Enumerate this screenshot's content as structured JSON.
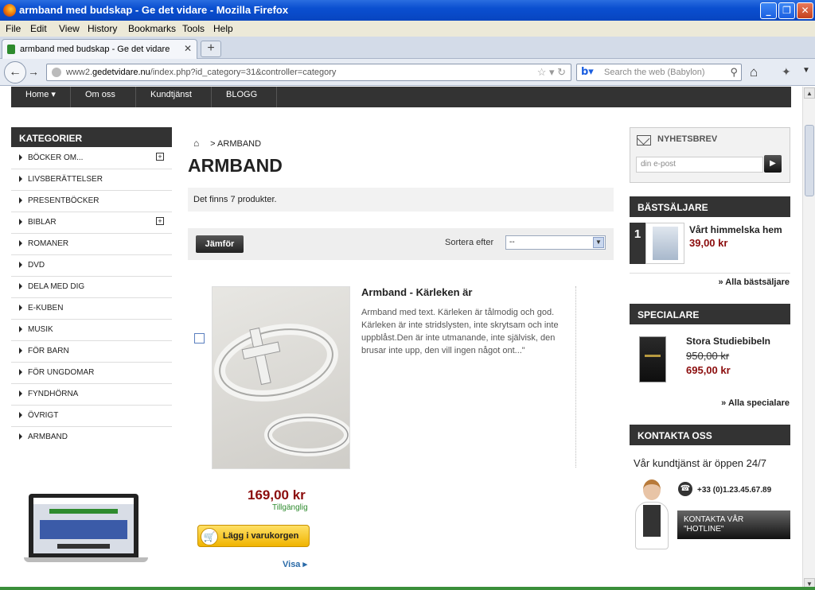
{
  "window": {
    "title": "armband med budskap - Ge det vidare - Mozilla Firefox"
  },
  "menu": {
    "items": [
      "File",
      "Edit",
      "View",
      "History",
      "Bookmarks",
      "Tools",
      "Help"
    ]
  },
  "tabs": [
    {
      "label": "armband med budskap - Ge det vidare"
    }
  ],
  "address": {
    "prefix": "www2.",
    "domain": "gedetvidare.nu",
    "path": "/index.php?id_category=31&controller=category"
  },
  "search": {
    "placeholder": "Search the web (Babylon)"
  },
  "site_nav": [
    "Home",
    "Om oss",
    "Kundtjänst",
    "BLOGG"
  ],
  "categories": {
    "heading": "KATEGORIER",
    "items": [
      "BÖCKER OM...",
      "LIVSBERÄTTELSER",
      "PRESENTBÖCKER",
      "BIBLAR",
      "ROMANER",
      "DVD",
      "DELA MED DIG",
      "E-KUBEN",
      "MUSIK",
      "FÖR BARN",
      "FÖR UNGDOMAR",
      "FYNDHÖRNA",
      "ÖVRIGT",
      "ARMBAND"
    ]
  },
  "breadcrumb": {
    "current": "ARMBAND"
  },
  "category": {
    "title": "ARMBAND",
    "count_text": "Det finns 7 produkter."
  },
  "sort": {
    "compare_label": "Jämför",
    "label": "Sortera efter",
    "value": "--"
  },
  "product": {
    "name": "Armband - Kärleken är",
    "description": "Armband med text. Kärleken är tålmodig och god. Kärleken är inte stridslysten, inte skrytsam och inte uppblåst.Den är inte utmanande, inte självisk, den brusar inte upp, den vill ingen något ont...\"",
    "price": "169,00 kr",
    "availability": "Tillgänglig",
    "cart_label": "Lägg i varukorgen",
    "view_label": "Visa"
  },
  "newsletter": {
    "heading": "NYHETSBREV",
    "placeholder": "din e-post"
  },
  "bestsellers": {
    "heading": "BÄSTSÄLJARE",
    "rank": "1",
    "name": "Vårt himmelska hem",
    "price": "39,00 kr",
    "all_link": "» Alla bästsäljare"
  },
  "specials": {
    "heading": "SPECIALARE",
    "name": "Stora Studiebibeln",
    "old_price": "950,00 kr",
    "new_price": "695,00 kr",
    "all_link": "» Alla specialare"
  },
  "contact": {
    "heading": "KONTAKTA OSS",
    "text": "Vår kundtjänst är öppen 24/7",
    "phone": "+33 (0)1.23.45.67.89",
    "hotline": "KONTAKTA VÅR \"HOTLINE\""
  }
}
